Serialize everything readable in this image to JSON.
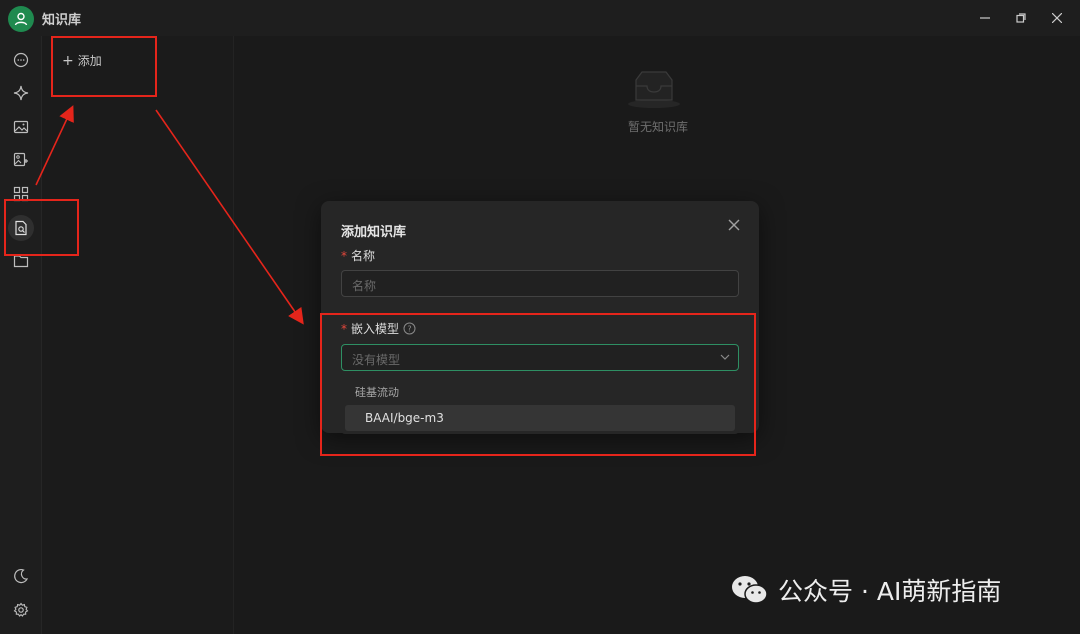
{
  "window": {
    "title": "知识库",
    "minimize_icon": "minimize-icon",
    "maximize_icon": "restore-icon",
    "close_icon": "close-icon"
  },
  "sidebar": {
    "icons": [
      "chat-icon",
      "sparkle-icon",
      "image-icon",
      "translate-image-icon",
      "apps-icon",
      "knowledge-base-icon",
      "folder-icon",
      "moon-icon",
      "settings-icon"
    ],
    "active": "knowledge-base-icon"
  },
  "list_panel": {
    "add_label": "添加"
  },
  "main": {
    "empty_text": "暂无知识库"
  },
  "modal": {
    "title": "添加知识库",
    "name_label": "名称",
    "name_placeholder": "名称",
    "model_label": "嵌入模型",
    "model_placeholder": "没有模型",
    "dropdown": {
      "group": "硅基流动",
      "options": [
        "BAAI/bge-m3"
      ]
    }
  },
  "watermark": {
    "text": "公众号 · AI萌新指南"
  },
  "colors": {
    "accent_green": "#2e8f63",
    "annotation_red": "#e5251b",
    "required_red": "#e5483c"
  }
}
